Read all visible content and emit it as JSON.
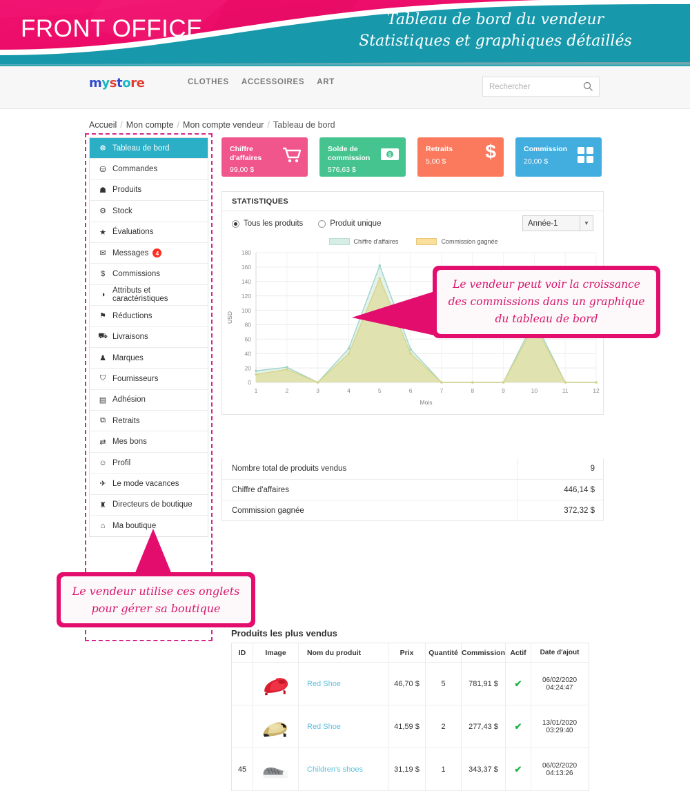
{
  "banner": {
    "left_title": "FRONT OFFICE",
    "right_line1": "Tableau de bord du vendeur",
    "right_line2": "Statistiques et graphiques détaillés",
    "pink": "#ec0a66",
    "teal": "#1799ab"
  },
  "header": {
    "logo_my": "my",
    "logo_y": "y",
    "logo_s": "s",
    "logo_t": "t",
    "logo_o": "o",
    "logo_re": "re",
    "nav": [
      "CLOTHES",
      "ACCESSOIRES",
      "ART"
    ],
    "search_placeholder": "Rechercher",
    "search_value": ""
  },
  "breadcrumb": [
    "Accueil",
    "Mon compte",
    "Mon compte vendeur",
    "Tableau de bord"
  ],
  "sidebar": {
    "items": [
      {
        "label": "Tableau de bord",
        "icon": "☸",
        "active": true
      },
      {
        "label": "Commandes",
        "icon": "⛁",
        "active": false
      },
      {
        "label": "Produits",
        "icon": "☗",
        "active": false
      },
      {
        "label": "Stock",
        "icon": "⚙",
        "active": false
      },
      {
        "label": "Évaluations",
        "icon": "★",
        "active": false
      },
      {
        "label": "Messages",
        "icon": "✉",
        "active": false,
        "badge": "4"
      },
      {
        "label": "Commissions",
        "icon": "$",
        "active": false
      },
      {
        "label": "Attributs et caractéristiques",
        "icon": "◑",
        "active": false
      },
      {
        "label": "Réductions",
        "icon": "⚑",
        "active": false
      },
      {
        "label": "Livraisons",
        "icon": "⛟",
        "active": false
      },
      {
        "label": "Marques",
        "icon": "♟",
        "active": false
      },
      {
        "label": "Fournisseurs",
        "icon": "⛉",
        "active": false
      },
      {
        "label": "Adhésion",
        "icon": "▤",
        "active": false
      },
      {
        "label": "Retraits",
        "icon": "⧉",
        "active": false
      },
      {
        "label": "Mes bons",
        "icon": "⇄",
        "active": false
      },
      {
        "label": "Profil",
        "icon": "☺",
        "active": false
      },
      {
        "label": "Le mode vacances",
        "icon": "✈",
        "active": false
      },
      {
        "label": "Directeurs de boutique",
        "icon": "♜",
        "active": false
      },
      {
        "label": "Ma boutique",
        "icon": "⌂",
        "active": false
      }
    ]
  },
  "cards": [
    {
      "label": "Chiffre d'affaires",
      "value": "99,00 $",
      "icon": "🛒",
      "color": "#f0568b"
    },
    {
      "label": "Solde de commission",
      "value": "576,63 $",
      "icon": "💵",
      "color": "#46c490"
    },
    {
      "label": "Retraits",
      "value": "5,00 $",
      "icon": "$",
      "color": "#fb7a5d"
    },
    {
      "label": "Commission",
      "value": "20,00 $",
      "icon": "▦",
      "color": "#42aee0"
    }
  ],
  "statistics": {
    "title": "STATISTIQUES",
    "radio_all": "Tous les produits",
    "radio_single": "Produit unique",
    "selected_radio": "all",
    "year_value": "Année-1",
    "summary_rows": [
      {
        "label": "Nombre total de produits vendus",
        "value": "9"
      },
      {
        "label": "Chiffre d'affaires",
        "value": "446,14 $"
      },
      {
        "label": "Commission gagnée",
        "value": "372,32 $"
      }
    ]
  },
  "chart_data": {
    "type": "area",
    "title": "",
    "xlabel": "Mois",
    "ylabel": "USD",
    "x": [
      1,
      2,
      3,
      4,
      5,
      6,
      7,
      8,
      9,
      10,
      11,
      12
    ],
    "categories": [
      "1",
      "2",
      "3",
      "4",
      "5",
      "6",
      "7",
      "8",
      "9",
      "10",
      "11",
      "12"
    ],
    "ylim": [
      0,
      180
    ],
    "yticks": [
      0,
      20,
      40,
      60,
      80,
      100,
      120,
      140,
      160,
      180
    ],
    "grid": true,
    "legend_position": "top-center",
    "series": [
      {
        "name": "Chiffre d'affaires",
        "color": "#d7eee6",
        "line_color": "#9fd4c8",
        "values": [
          16,
          21,
          0,
          47,
          162,
          46,
          0,
          0,
          0,
          86,
          0,
          0
        ]
      },
      {
        "name": "Commission gagnée",
        "color": "#dfe0a8",
        "line_color": "#d7d48a",
        "values": [
          11,
          18,
          0,
          40,
          144,
          40,
          0,
          0,
          0,
          80,
          0,
          0
        ]
      }
    ]
  },
  "products": {
    "title": "Produits les plus vendus",
    "columns": [
      "ID",
      "Image",
      "Nom du produit",
      "Prix",
      "Quantité",
      "Commission",
      "Actif",
      "Date d'ajout"
    ],
    "rows": [
      {
        "id": "",
        "image": "red-heels",
        "name": "Red Shoe",
        "prix": "46,70 $",
        "quantite": "5",
        "commission": "781,91 $",
        "actif": "✔",
        "date": "06/02/2020 04:24:47"
      },
      {
        "id": "",
        "image": "gold-heels",
        "name": "Red Shoe",
        "prix": "41,59 $",
        "quantite": "2",
        "commission": "277,43 $",
        "actif": "✔",
        "date": "13/01/2020 03:29:40"
      },
      {
        "id": "45",
        "image": "grey-sneakers",
        "name": "Children's shoes",
        "prix": "31,19 $",
        "quantite": "1",
        "commission": "343,37 $",
        "actif": "✔",
        "date": "06/02/2020 04:13:26"
      }
    ]
  },
  "callouts": {
    "chart": "Le vendeur peut voir la croissance des commissions dans un graphique du tableau de bord",
    "menu": "Le vendeur utilise ces onglets pour gérer sa boutique"
  }
}
